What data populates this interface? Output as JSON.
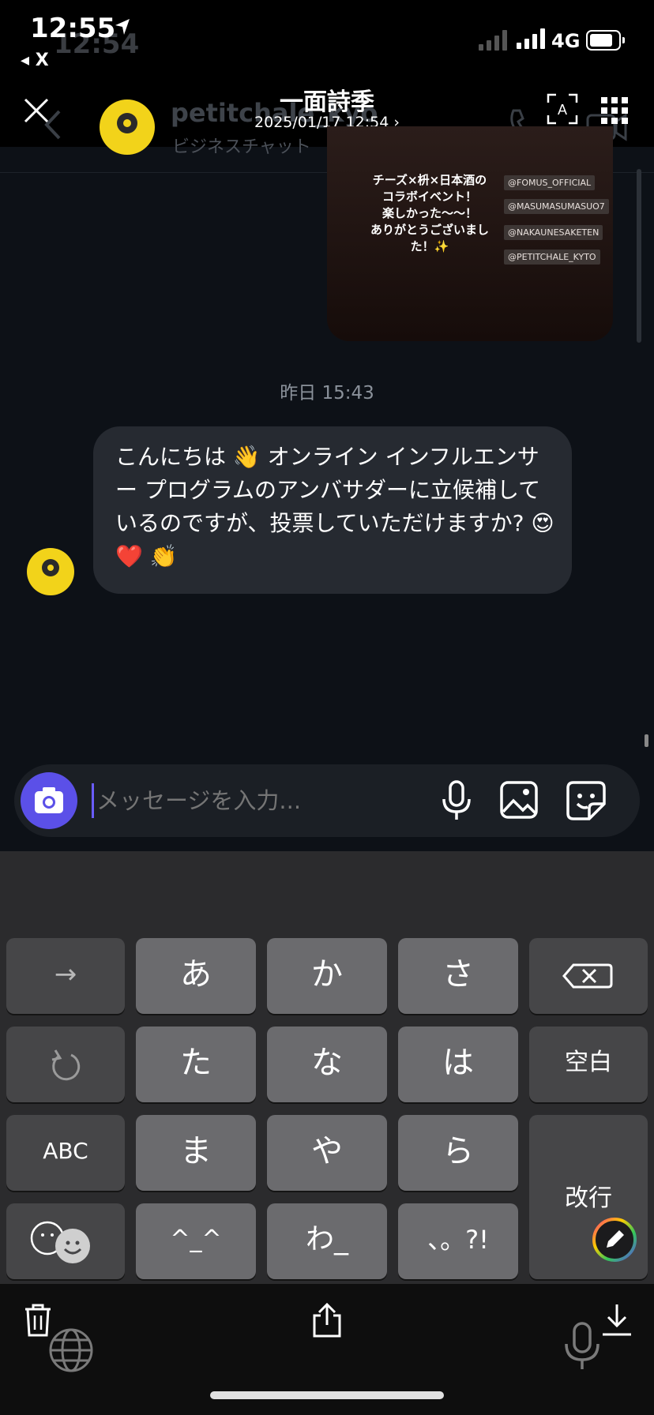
{
  "status_bar": {
    "time": "12:55",
    "time_ghost": "12:54",
    "back_app": "◂ X",
    "network": "4G"
  },
  "viewer": {
    "title": "一面詩季",
    "date": "2025/01/17 12:54 ›"
  },
  "chat_header": {
    "name": "petitchale_kyo",
    "subtitle": "ビジネスチャット"
  },
  "story": {
    "text": "チーズ×枡×日本酒の\nコラボイベント！\n楽しかった〜〜！\nありがとうございまし\nた！✨",
    "tags": [
      "@FOMUS_OFFICIAL",
      "@MASUMASUMASUO7",
      "@NAKAUNESAKETEN",
      "@PETITCHALE_KYTO"
    ]
  },
  "messages": {
    "timestamp": "昨日 15:43",
    "received_text": "こんにちは 👋 オンライン インフルエンサー プログラムのアンバサダーに立候補しているのですが、投票していただけますか? 😍 ❤️ 👏"
  },
  "composer": {
    "placeholder": "メッセージを入力..."
  },
  "keyboard": {
    "row1": [
      "→",
      "あ",
      "か",
      "さ",
      "⌫"
    ],
    "row2": [
      "↺",
      "た",
      "な",
      "は",
      "空白"
    ],
    "row3": [
      "ABC",
      "ま",
      "や",
      "ら"
    ],
    "row4": [
      "☺",
      "^_^",
      "わ_",
      "、。?!"
    ],
    "enter": "改行"
  },
  "colors": {
    "accent": "#5b50e8",
    "bubble": "#262a31",
    "background": "#0d1117",
    "brand_yellow": "#f2d31a"
  }
}
